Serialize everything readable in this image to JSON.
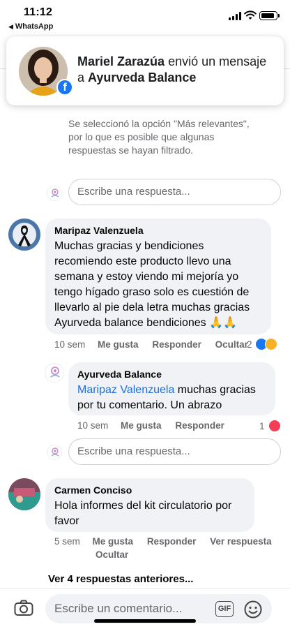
{
  "status_bar": {
    "time": "11:12",
    "back_app": "WhatsApp"
  },
  "banner": {
    "sender": "Mariel Zarazúa",
    "action": " envió un mensaje a ",
    "page": "Ayurveda Balance"
  },
  "filter_notice": "Se seleccionó la opción \"Más relevantes\", por lo que es posible que algunas respuestas se hayan filtrado.",
  "reply_placeholder": "Escribe una respuesta...",
  "comments": [
    {
      "author": "Maripaz Valenzuela",
      "text": "Muchas gracias y bendiciones recomiendo este producto llevo una semana y estoy viendo mi mejoría yo tengo hígado graso solo es cuestión de llevarlo al pie dela letra muchas gracias Ayurveda balance bendiciones 🙏🙏",
      "time": "10 sem",
      "like": "Me gusta",
      "reply": "Responder",
      "hide": "Ocultar",
      "reaction_count": "2"
    },
    {
      "author": "Carmen Conciso",
      "text": "Hola informes del kit circulatorio por favor",
      "time": "5 sem",
      "like": "Me gusta",
      "reply": "Responder",
      "see_reply": "Ver respuesta",
      "hide": "Ocultar"
    }
  ],
  "page_reply": {
    "author": "Ayurveda Balance",
    "mention": "Maripaz Valenzuela",
    "text": " muchas gracias por tu comentario. Un abrazo",
    "time": "10 sem",
    "like": "Me gusta",
    "reply": "Responder",
    "reaction_count": "1"
  },
  "previous_replies": "Ver 4 respuestas anteriores...",
  "composer": {
    "placeholder": "Escribe un comentario...",
    "gif_label": "GIF"
  },
  "icons": [
    "camera-icon",
    "gif-icon",
    "emoji-icon",
    "facebook-icon",
    "like-reaction-icon",
    "sad-reaction-icon",
    "love-reaction-icon",
    "wifi-icon",
    "battery-icon",
    "signal-icon"
  ],
  "colors": {
    "facebook_blue": "#1877f2",
    "mention_blue": "#216fdb",
    "bubble_bg": "#f0f2f5",
    "meta_gray": "#65676b",
    "love_red": "#f33e58"
  }
}
